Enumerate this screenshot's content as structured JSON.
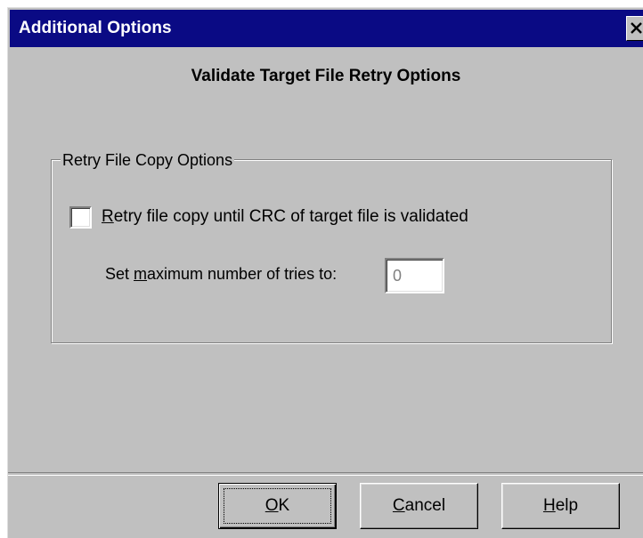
{
  "window": {
    "title": "Additional Options",
    "close_icon": "close-icon"
  },
  "dialog": {
    "heading": "Validate Target File Retry Options"
  },
  "group": {
    "legend": "Retry File Copy Options",
    "checkbox": {
      "mnemonic": "R",
      "label_rest": "etry file copy until CRC of target file is validated",
      "checked": false
    },
    "tries": {
      "label_pre": "Set ",
      "mnemonic": "m",
      "label_post": "aximum number of tries to:",
      "value": "0"
    }
  },
  "buttons": {
    "ok": {
      "mnemonic": "O",
      "rest": "K"
    },
    "cancel": {
      "mnemonic": "C",
      "rest": "ancel"
    },
    "help": {
      "mnemonic": "H",
      "rest": "elp"
    }
  },
  "colors": {
    "titlebar": "#0a0a84",
    "face": "#c0c0c0"
  }
}
